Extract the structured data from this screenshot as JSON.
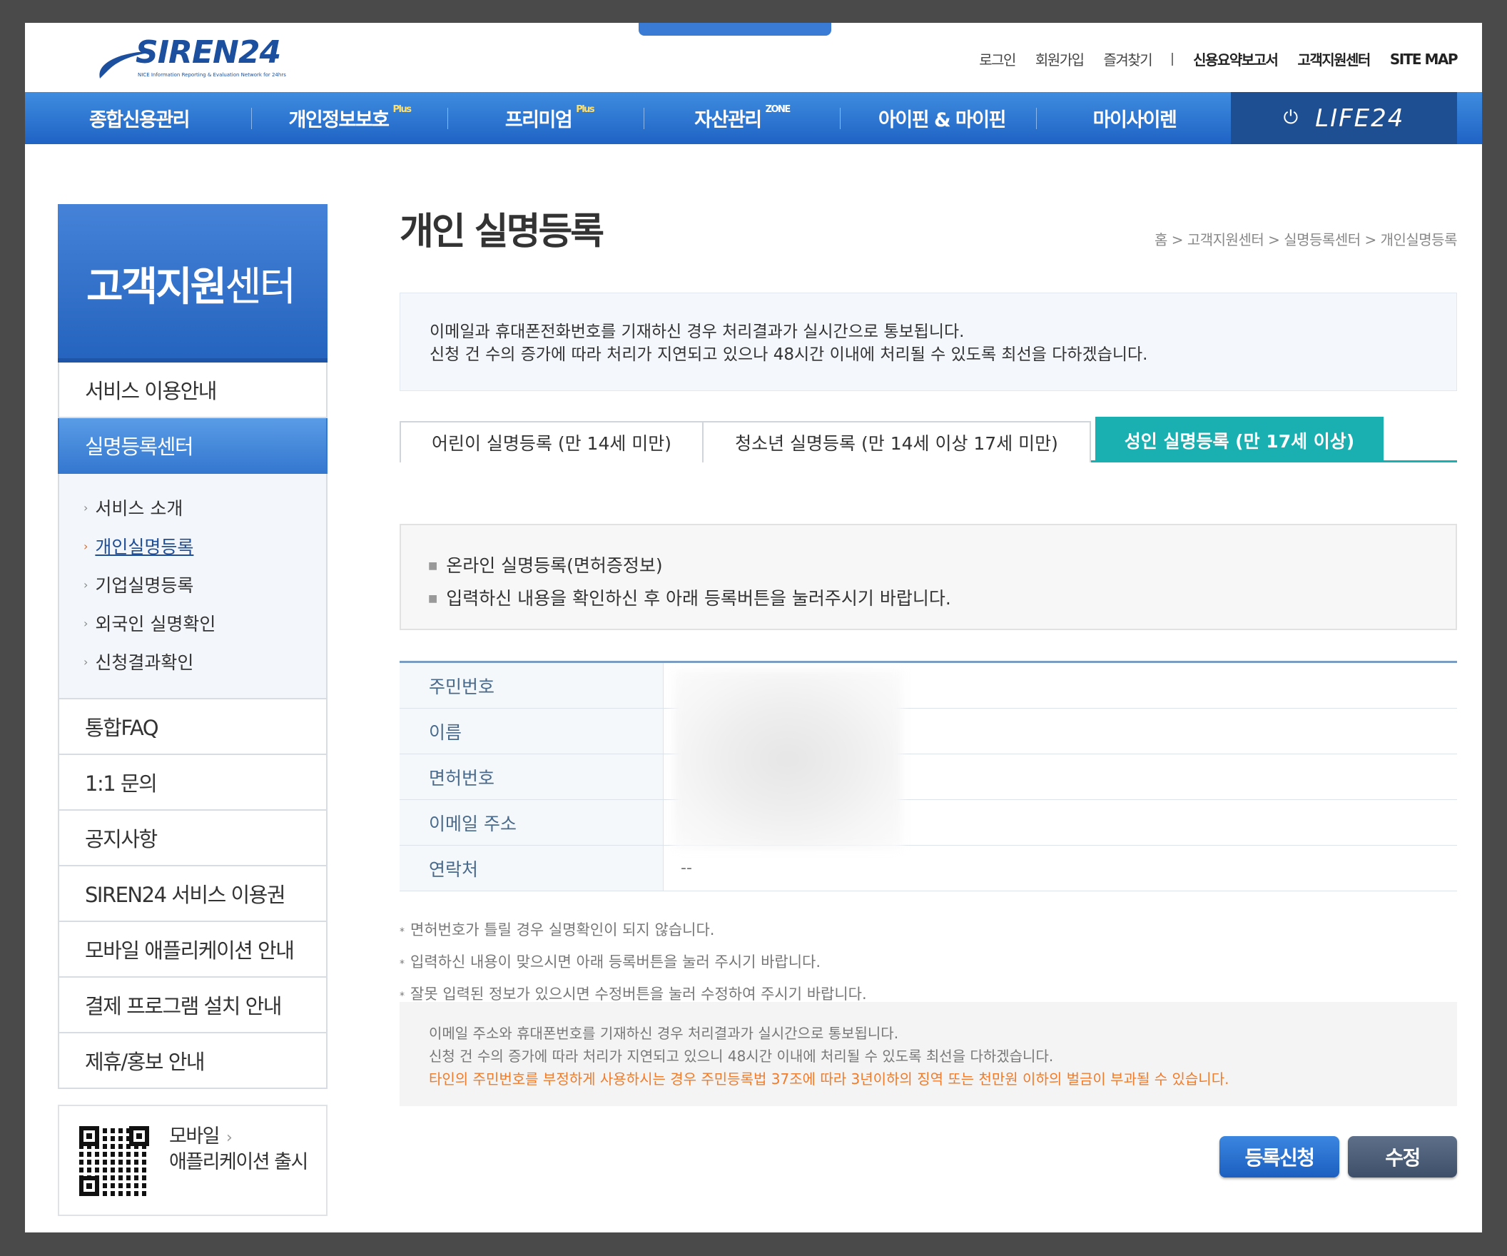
{
  "header": {
    "logo_text": "SIREN24",
    "logo_sub": "NICE Information Reporting & Evaluation Network for 24hrs",
    "util_nav": [
      "로그인",
      "회원가입",
      "즐겨찾기"
    ],
    "util_nav_strong": [
      "신용요약보고서",
      "고객지원센터",
      "SITE MAP"
    ]
  },
  "gnb": {
    "items": [
      {
        "label": "종합신용관리",
        "tag": ""
      },
      {
        "label": "개인정보보호",
        "tag": "Plus"
      },
      {
        "label": "프리미엄",
        "tag": "Plus"
      },
      {
        "label": "자산관리",
        "tag": "ZONE"
      },
      {
        "label": "아이핀 & 마이핀",
        "tag": ""
      },
      {
        "label": "마이사이렌",
        "tag": ""
      }
    ],
    "life_label": "LIFE24"
  },
  "sidebar": {
    "title_strong": "고객지원",
    "title_light": "센터",
    "items": [
      {
        "label": "서비스 이용안내"
      },
      {
        "label": "실명등록센터"
      }
    ],
    "sub_items": [
      {
        "label": "서비스 소개"
      },
      {
        "label": "개인실명등록"
      },
      {
        "label": "기업실명등록"
      },
      {
        "label": "외국인 실명확인"
      },
      {
        "label": "신청결과확인"
      }
    ],
    "items_after": [
      {
        "label": "통합FAQ"
      },
      {
        "label": "1:1 문의"
      },
      {
        "label": "공지사항"
      },
      {
        "label": "SIREN24 서비스 이용권"
      },
      {
        "label": "모바일 애플리케이션 안내"
      },
      {
        "label": "결제 프로그램 설치 안내"
      },
      {
        "label": "제휴/홍보 안내"
      }
    ],
    "qr_line1": "모바일",
    "qr_line2": "애플리케이션 출시"
  },
  "main": {
    "title": "개인 실명등록",
    "breadcrumb": "홈 > 고객지원센터 > 실명등록센터 > 개인실명등록",
    "info_line1": "이메일과 휴대폰전화번호를 기재하신 경우 처리결과가 실시간으로 통보됩니다.",
    "info_line2": "신청 건 수의 증가에 따라 처리가 지연되고 있으나 48시간 이내에 처리될 수 있도록 최선을 다하겠습니다.",
    "tabs": [
      {
        "label": "어린이 실명등록 (만 14세 미만)"
      },
      {
        "label": "청소년 실명등록 (만 14세 이상 17세 미만)"
      },
      {
        "label": "성인 실명등록 (만 17세 이상)"
      }
    ],
    "notice_line1": "온라인 실명등록(면허증정보)",
    "notice_line2": "입력하신 내용을 확인하신 후 아래 등록버튼을 눌러주시기 바랍니다.",
    "form_rows": [
      {
        "label": "주민번호",
        "value": ""
      },
      {
        "label": "이름",
        "value": ""
      },
      {
        "label": "면허번호",
        "value": ""
      },
      {
        "label": "이메일 주소",
        "value": ""
      },
      {
        "label": "연락처",
        "value": "--"
      }
    ],
    "notes": [
      "면허번호가 틀릴 경우 실명확인이 되지 않습니다.",
      "입력하신 내용이 맞으시면 아래 등록버튼을 눌러 주시기 바랍니다.",
      "잘못 입력된 정보가 있으시면 수정버튼을 눌러 수정하여 주시기 바랍니다."
    ],
    "bottom_line1": "이메일 주소와 휴대폰번호를 기재하신 경우 처리결과가 실시간으로 통보됩니다.",
    "bottom_line2": "신청 건 수의 증가에 따라 처리가 지연되고 있으니 48시간 이내에 처리될 수 있도록 최선을 다하겠습니다.",
    "bottom_warn": "타인의 주민번호를 부정하게 사용하시는 경우 주민등록법 37조에 따라 3년이하의 징역 또는 천만원 이하의 벌금이 부과될 수 있습니다.",
    "btn_submit": "등록신청",
    "btn_edit": "수정"
  },
  "colors": {
    "brand_blue": "#2463be",
    "tab_active": "#1aafb0",
    "warning": "#f07b2a"
  }
}
